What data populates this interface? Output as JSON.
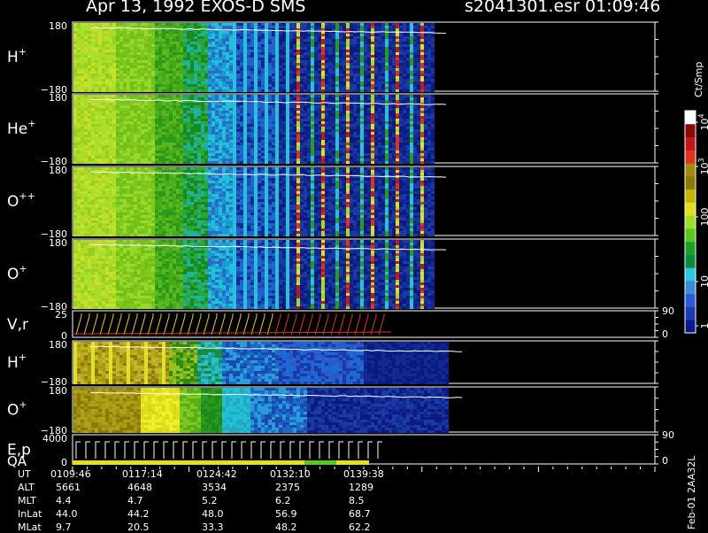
{
  "header": {
    "title": "Apr 13, 1992   EXOS-D SMS",
    "file": "s2041301.esr",
    "time": "01:09:46"
  },
  "chart_data": {
    "type": "heatmap",
    "panels": [
      {
        "id": "h1",
        "label": "H",
        "sup": "+",
        "ymax": "180",
        "ymin": "−180",
        "kind": "spectrogram",
        "pattern": "A",
        "extent_frac": 0.62
      },
      {
        "id": "he",
        "label": "He",
        "sup": "+",
        "ymax": "180",
        "ymin": "−180",
        "kind": "spectrogram",
        "pattern": "A",
        "extent_frac": 0.62
      },
      {
        "id": "opp",
        "label": "O",
        "sup": "++",
        "ymax": "180",
        "ymin": "−180",
        "kind": "spectrogram",
        "pattern": "A",
        "extent_frac": 0.62
      },
      {
        "id": "op",
        "label": "O",
        "sup": "+",
        "ymax": "180",
        "ymin": "−180",
        "kind": "spectrogram",
        "pattern": "A",
        "extent_frac": 0.62
      },
      {
        "id": "vr",
        "label": "V,r",
        "sup": "",
        "ymax": "25",
        "ymin": "0",
        "right_max": "90",
        "right_min": "0",
        "kind": "line"
      },
      {
        "id": "h2",
        "label": "H",
        "sup": "+",
        "ymax": "180",
        "ymin": "−180",
        "kind": "spectrogram",
        "pattern": "B",
        "extent_frac": 0.64
      },
      {
        "id": "o2",
        "label": "O",
        "sup": "+",
        "ymax": "180",
        "ymin": "−180",
        "kind": "spectrogram",
        "pattern": "C",
        "extent_frac": 0.64
      },
      {
        "id": "ep",
        "label": "E,p",
        "label2": "QA",
        "sup": "",
        "ymax": "4000",
        "ymin": "0",
        "right_max": "90",
        "right_min": "0",
        "kind": "line"
      }
    ],
    "colorbar": {
      "unit": "Ct/Smp",
      "tick_labels": [
        "1",
        "10",
        "100",
        "10",
        "10"
      ],
      "tick_exps": [
        "",
        "",
        "",
        "3",
        "4"
      ],
      "colors": [
        "#0c1a8a",
        "#1c3ab4",
        "#2a5ad8",
        "#3f8ad8",
        "#28c8e0",
        "#0a8a3a",
        "#1aa02a",
        "#5ac81a",
        "#9ae028",
        "#e0e020",
        "#c8b400",
        "#8a7a00",
        "#a08a10",
        "#e03020",
        "#c01818",
        "#8a0808",
        "#ffffff"
      ]
    },
    "footer": {
      "rows": [
        {
          "name": "UT",
          "values": [
            "0109:46",
            "0117:14",
            "0124:42",
            "0132:10",
            "0139:38"
          ]
        },
        {
          "name": "ALT",
          "values": [
            "5661",
            "4648",
            "3534",
            "2375",
            "1289"
          ]
        },
        {
          "name": "MLT",
          "values": [
            "4.4",
            "4.7",
            "5.2",
            "6.2",
            "8.5"
          ]
        },
        {
          "name": "InLat",
          "values": [
            "44.0",
            "44.2",
            "48.0",
            "56.9",
            "68.7"
          ]
        },
        {
          "name": "MLat",
          "values": [
            "9.7",
            "20.5",
            "33.3",
            "48.2",
            "62.2"
          ]
        }
      ]
    },
    "side_note": "Feb-01 2AA32L"
  }
}
